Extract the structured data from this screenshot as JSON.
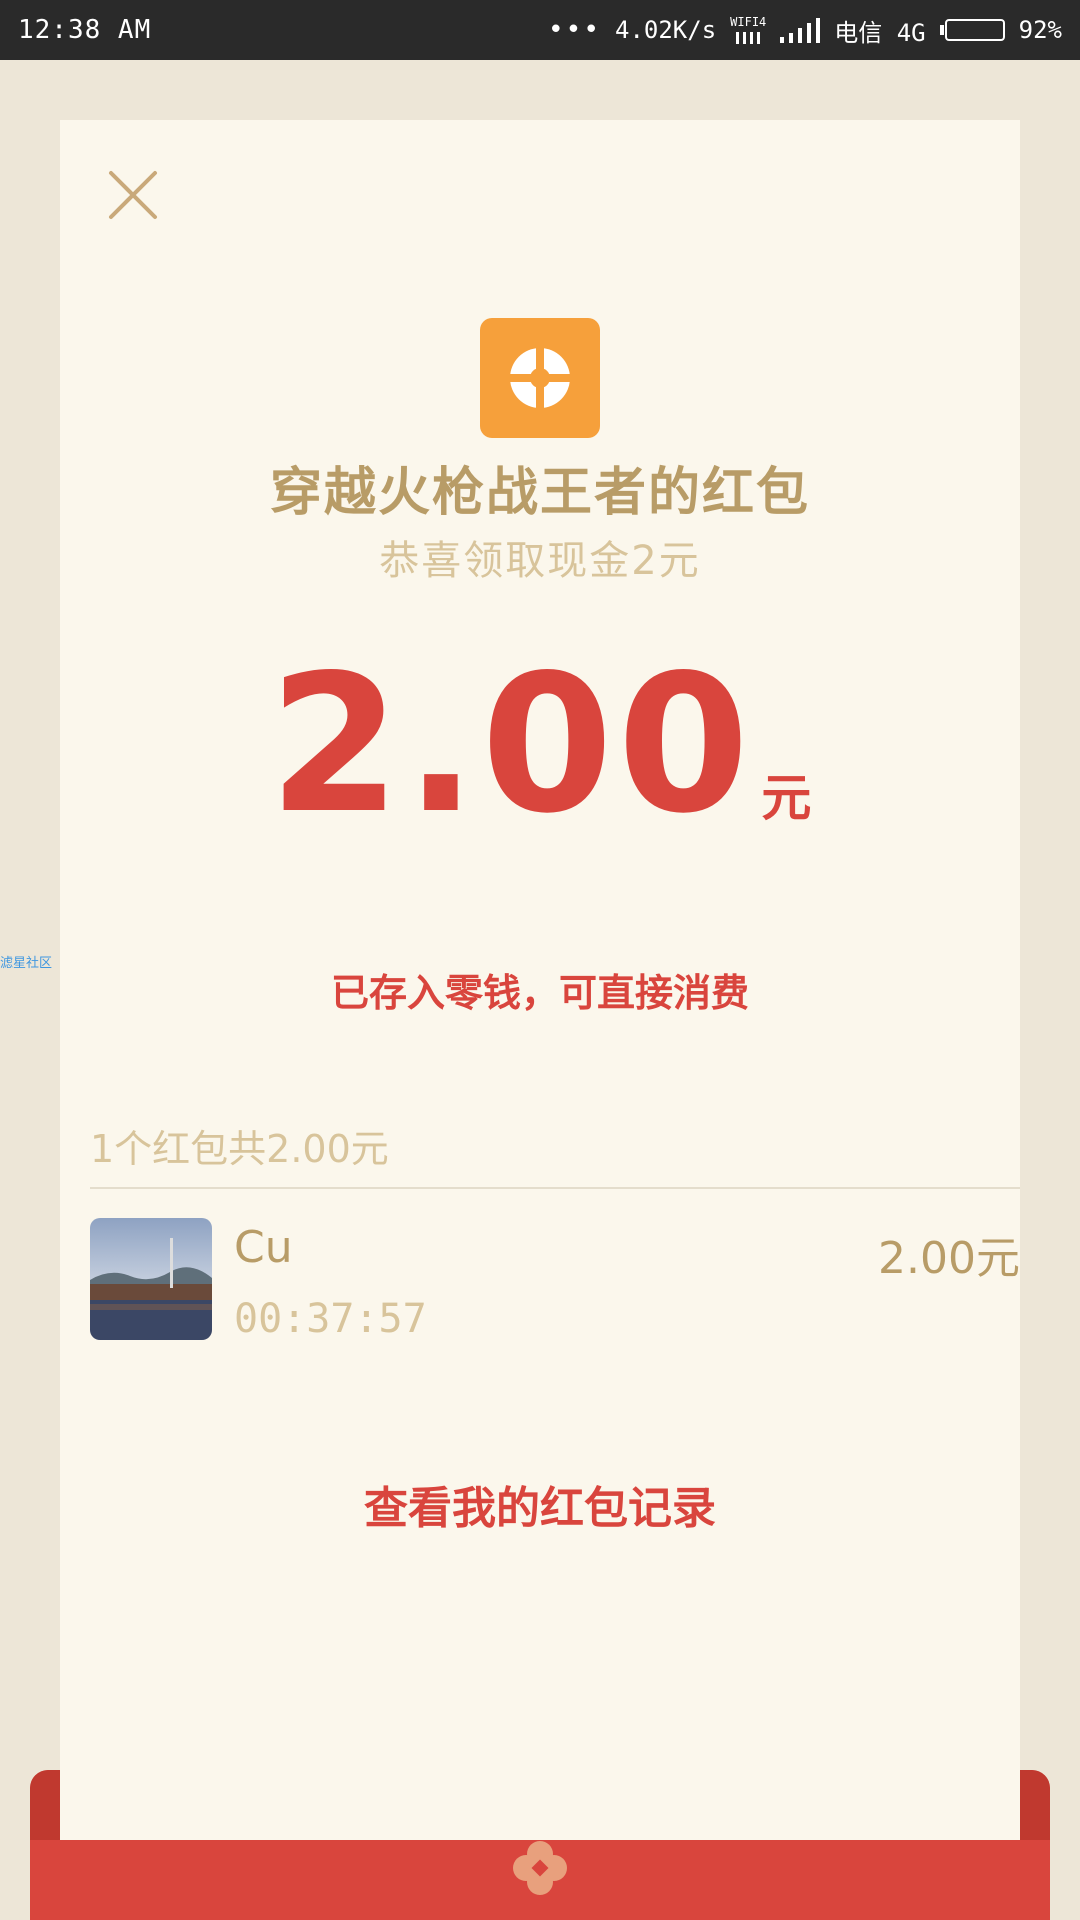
{
  "status_bar": {
    "time": "12:38 AM",
    "dots": "•••",
    "speed": "4.02K/s",
    "wifi_label": "WIFI4",
    "carrier": "电信 4G",
    "battery": "92%",
    "battery_level": 0.92,
    "battery_color": "#f5a01a"
  },
  "card": {
    "close_icon": "close-icon",
    "app_logo_icon": "app-logo-icon",
    "sender_title": "穿越火枪战王者的红包",
    "greeting": "恭喜领取现金2元",
    "amount": "2.00",
    "amount_unit": "元",
    "note": "已存入零钱，可直接消费",
    "summary": "1个红包共2.00元",
    "records": [
      {
        "name": "Cu",
        "time": "00:37:57",
        "amount": "2.00元"
      }
    ],
    "history_link": "查看我的红包记录"
  },
  "side_watermark": "滤星社区",
  "colors": {
    "accent_red": "#d9453d",
    "gold": "#b89c67",
    "light_gold": "#d8c49b",
    "card_bg": "#fbf7ec",
    "page_bg": "#ede6d7",
    "logo_orange": "#f6a03b"
  }
}
